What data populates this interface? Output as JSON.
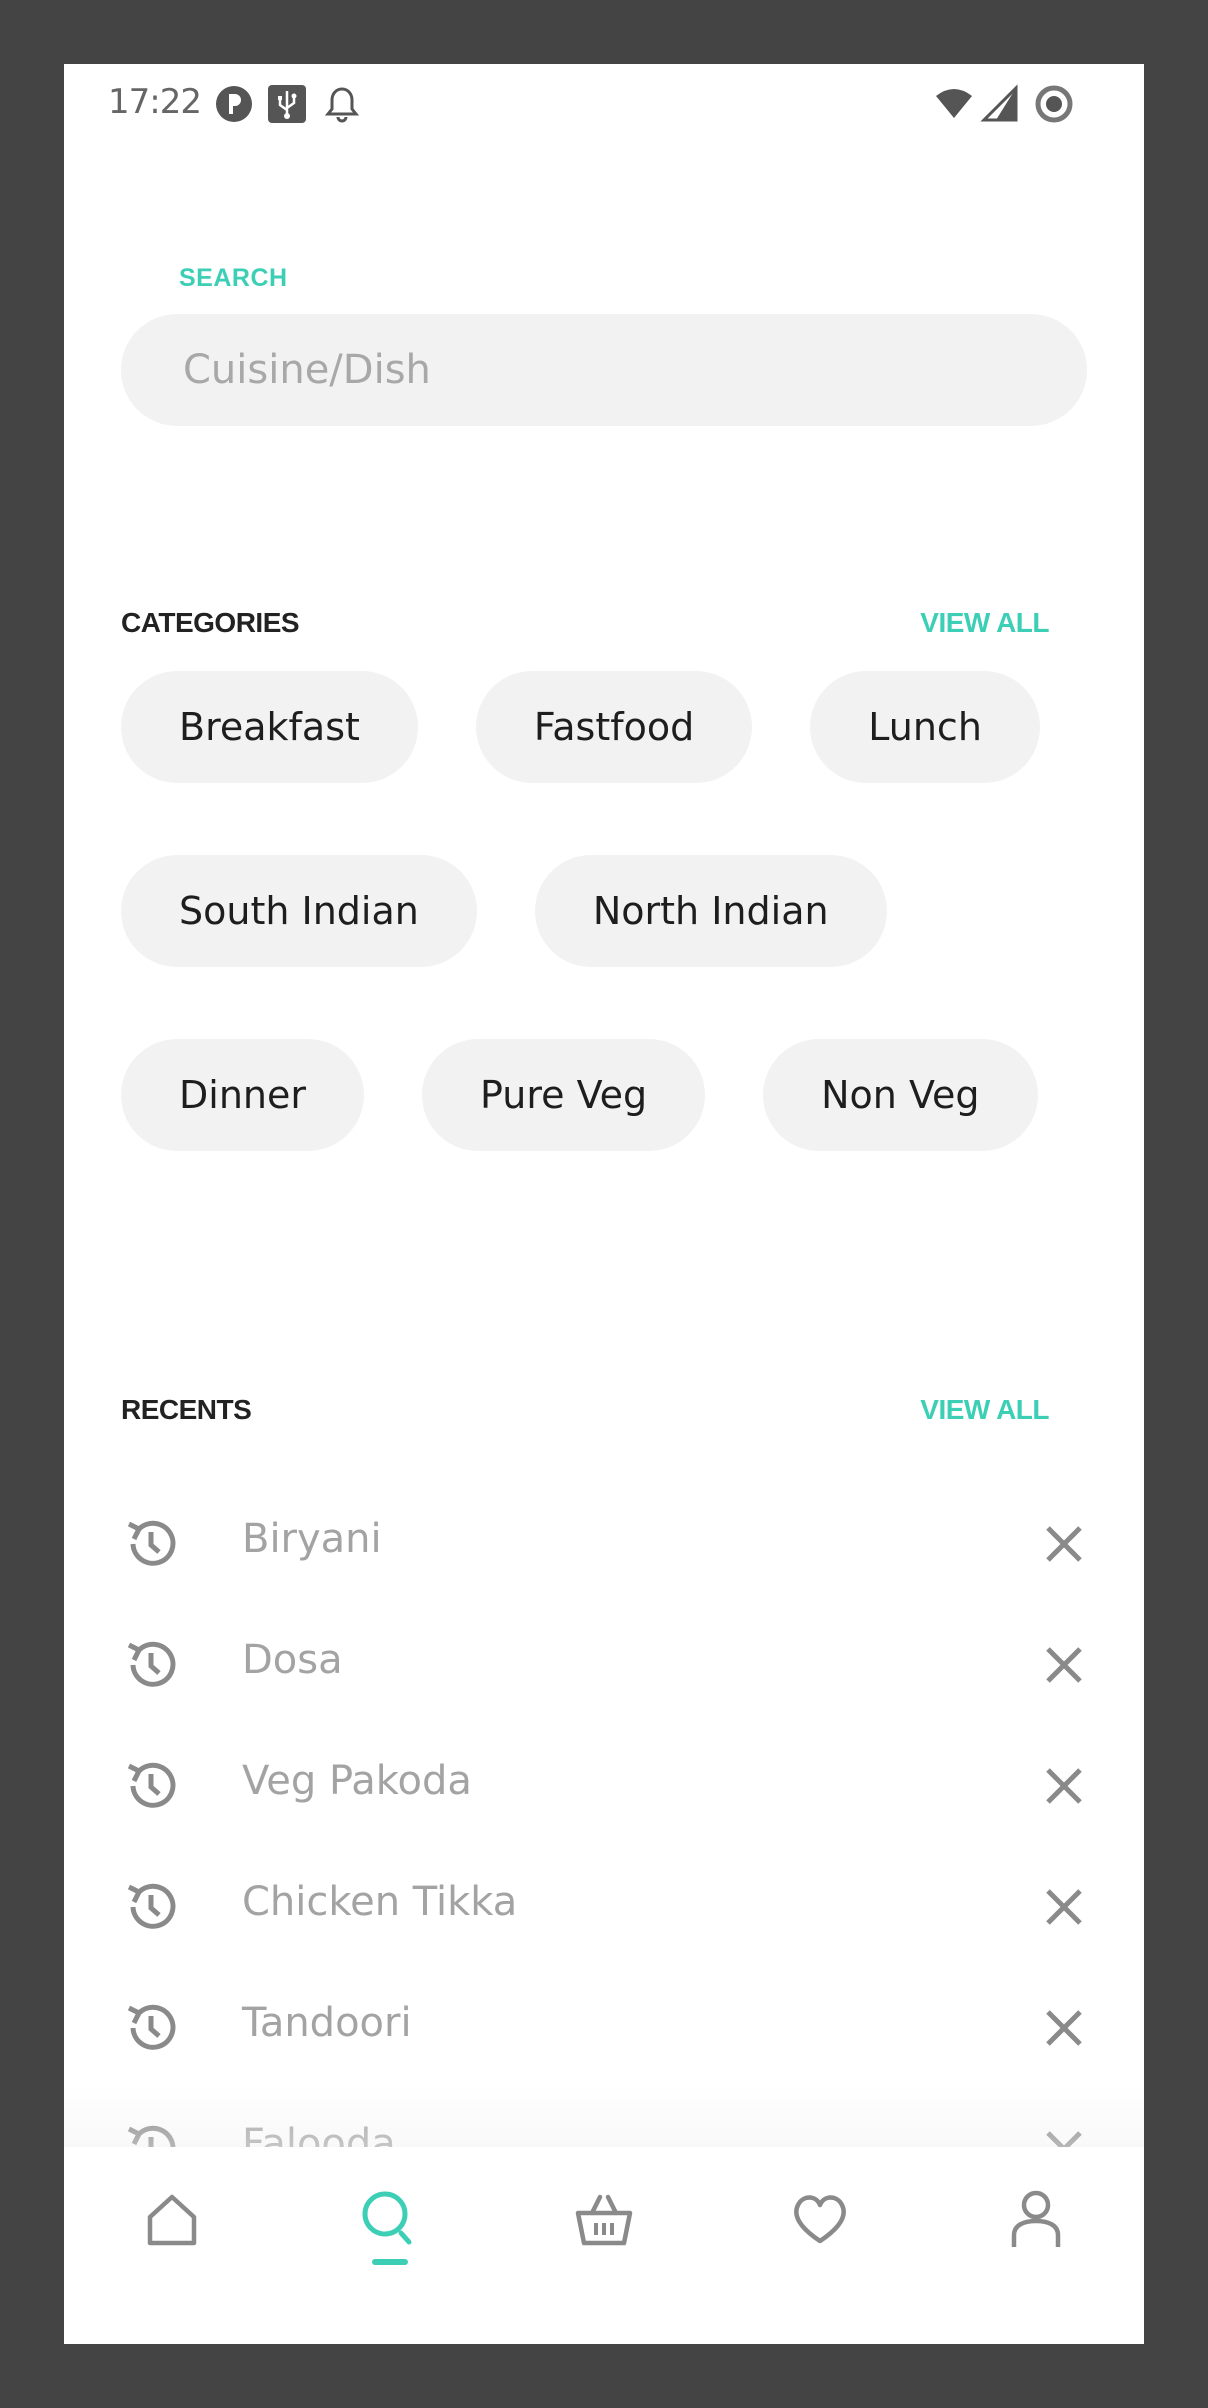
{
  "status_bar": {
    "time": "17:22",
    "left_icons": [
      "app-badge-icon",
      "usb-icon",
      "bell-icon"
    ],
    "right_icons": [
      "wifi-icon",
      "signal-icon",
      "battery-ring-icon"
    ]
  },
  "search": {
    "label": "SEARCH",
    "placeholder": "Cuisine/Dish"
  },
  "categories": {
    "title": "CATEGORIES",
    "view_all": "VIEW ALL",
    "rows": [
      [
        "Breakfast",
        "Fastfood",
        "Lunch"
      ],
      [
        "South Indian",
        "North Indian"
      ],
      [
        "Dinner",
        "Pure Veg",
        "Non Veg"
      ]
    ]
  },
  "recents": {
    "title": "RECENTS",
    "view_all": "VIEW ALL",
    "items": [
      "Biryani",
      "Dosa",
      "Veg Pakoda",
      "Chicken Tikka",
      "Tandoori",
      "Falooda"
    ]
  },
  "bottom_nav": {
    "items": [
      {
        "icon": "home-icon",
        "active": false
      },
      {
        "icon": "search-icon",
        "active": true
      },
      {
        "icon": "basket-icon",
        "active": false
      },
      {
        "icon": "heart-icon",
        "active": false
      },
      {
        "icon": "profile-icon",
        "active": false
      }
    ]
  },
  "colors": {
    "accent": "#3ccfb6",
    "chip_bg": "#f2f2f2",
    "muted_text": "#a3a3a3",
    "icon_gray": "#8a8a8a",
    "frame": "#444444"
  }
}
